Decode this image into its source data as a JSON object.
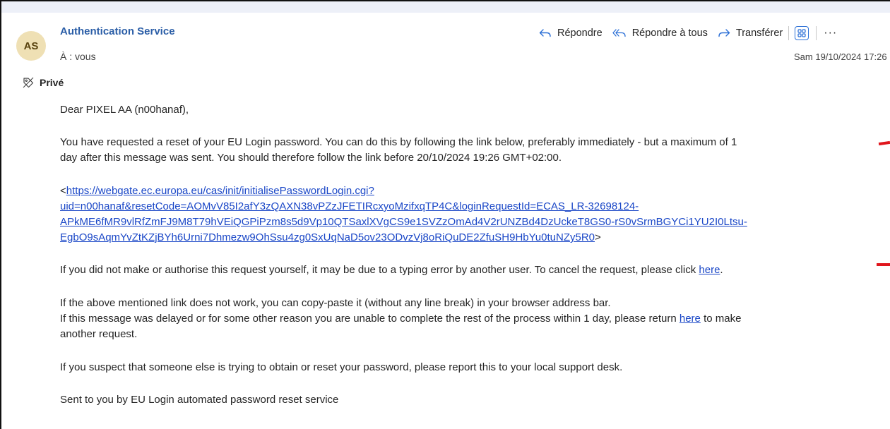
{
  "email": {
    "avatar_initials": "AS",
    "sender": "Authentication Service",
    "to": "À : vous",
    "date": "Sam 19/10/2024 17:26",
    "sensitivity": "Privé"
  },
  "actions": {
    "reply": "Répondre",
    "reply_all": "Répondre à tous",
    "forward": "Transférer",
    "more": "···"
  },
  "body": {
    "greeting": "Dear PIXEL AA (n00hanaf),",
    "p1_line1": "You have requested a reset of your EU Login password. You can do this by following the link below, preferably immediately - but a maximum of 1",
    "p1_line2": "day after this message was sent. You should therefore follow the link before 20/10/2024 19:26 GMT+02:00.",
    "link_open": "<",
    "link_line1": "https://webgate.ec.europa.eu/cas/init/initialisePasswordLogin.cgi?",
    "link_line2": "uid=n00hanaf&resetCode=AOMvV85I2afY3zQAXN38vPZzJFETIRcxyoMzifxqTP4C&loginRequestId=ECAS_LR-32698124-",
    "link_line3": "APkME6fMR9vlRfZmFJ9M8T79hVEiQGPiPzm8s5d9Vp10QTSaxlXVgCS9e1SVZzOmAd4V2rUNZBd4DzUckeT8GS0-rS0vSrmBGYCi1YU2I0Ltsu-",
    "link_line4": "EgbO9sAqmYvZtKZjBYh6Urni7Dhmezw9OhSsu4zg0SxUqNaD5ov23ODvzVj8oRiQuDE2ZfuSH9HbYu0tuNZy5R0",
    "link_close": ">",
    "p2_text": "If you did not make or authorise this request yourself, it may be due to a typing error by another user. To cancel the request, please click ",
    "p2_link": "here",
    "p2_end": ".",
    "p3_line1": "If the above mentioned link does not work, you can copy-paste it (without any line break) in your browser address bar.",
    "p3_line2_text": "If this message was delayed or for some other reason you are unable to complete the rest of the process within 1 day, please return ",
    "p3_line2_link": "here",
    "p3_line2_end": " to make",
    "p3_line3": "another request.",
    "p4": "If you suspect that someone else is trying to obtain or reset your password, please report this to your local support desk.",
    "p5": "Sent to you by EU Login automated password reset service"
  },
  "colors": {
    "link": "#1a47c7",
    "sender": "#2b5ea7",
    "accent_icon": "#2b6fd6",
    "annotation_mark": "#e0161d",
    "avatar_bg": "#efe0b4"
  }
}
